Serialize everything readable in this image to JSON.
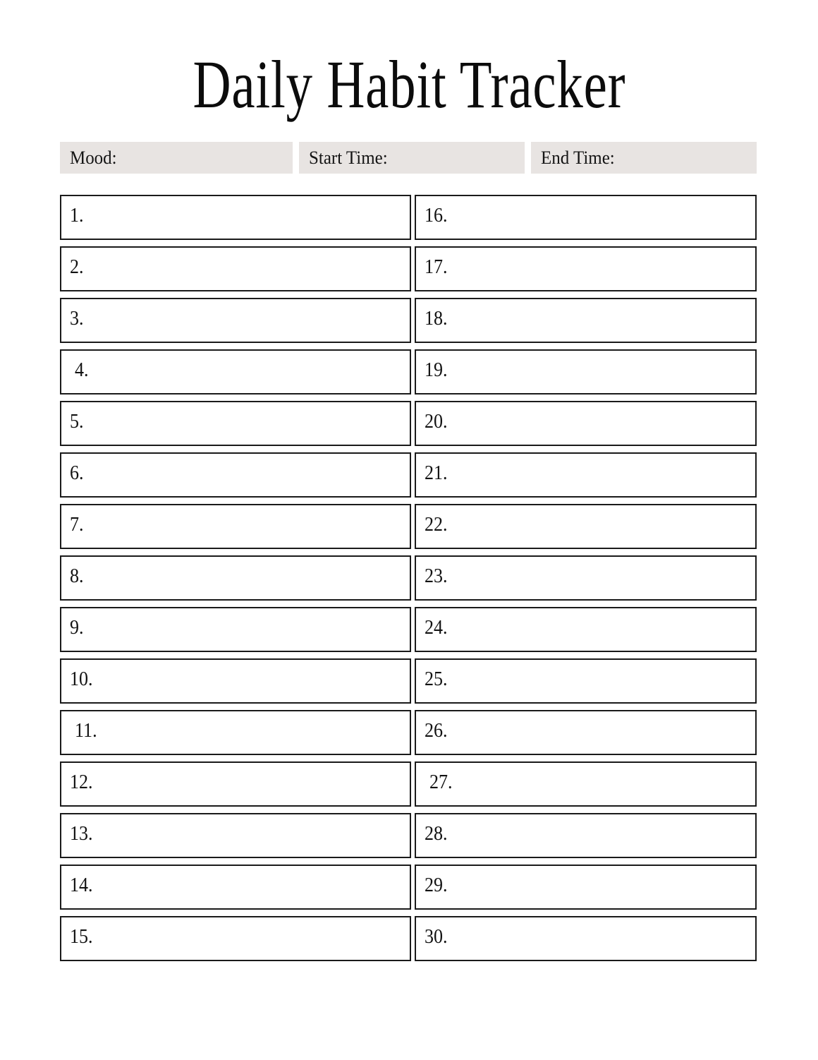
{
  "document": {
    "title": "Daily Habit Tracker",
    "accent_gray": "#E8E4E2",
    "border_color": "#1A1A1A",
    "background": "#FFFFFF"
  },
  "fields": [
    {
      "id": "mood",
      "label": "Mood:",
      "value": ""
    },
    {
      "id": "start_time",
      "label": "Start Time:",
      "value": ""
    },
    {
      "id": "end_time",
      "label": "End Time:",
      "value": ""
    }
  ],
  "checklist": {
    "left_column": [
      {
        "number": "1.",
        "value": "",
        "indent": false
      },
      {
        "number": "2.",
        "value": "",
        "indent": false
      },
      {
        "number": "3.",
        "value": "",
        "indent": false
      },
      {
        "number": "4.",
        "value": "",
        "indent": true
      },
      {
        "number": "5.",
        "value": "",
        "indent": false
      },
      {
        "number": "6.",
        "value": "",
        "indent": false
      },
      {
        "number": "7.",
        "value": "",
        "indent": false
      },
      {
        "number": "8.",
        "value": "",
        "indent": false
      },
      {
        "number": "9.",
        "value": "",
        "indent": false
      },
      {
        "number": "10.",
        "value": "",
        "indent": false
      },
      {
        "number": "11.",
        "value": "",
        "indent": true
      },
      {
        "number": "12.",
        "value": "",
        "indent": false
      },
      {
        "number": "13.",
        "value": "",
        "indent": false
      },
      {
        "number": "14.",
        "value": "",
        "indent": false
      },
      {
        "number": "15.",
        "value": "",
        "indent": false
      }
    ],
    "right_column": [
      {
        "number": "16.",
        "value": "",
        "indent": false
      },
      {
        "number": "17.",
        "value": "",
        "indent": false
      },
      {
        "number": "18.",
        "value": "",
        "indent": false
      },
      {
        "number": "19.",
        "value": "",
        "indent": false
      },
      {
        "number": "20.",
        "value": "",
        "indent": false
      },
      {
        "number": "21.",
        "value": "",
        "indent": false
      },
      {
        "number": "22.",
        "value": "",
        "indent": false
      },
      {
        "number": "23.",
        "value": "",
        "indent": false
      },
      {
        "number": "24.",
        "value": "",
        "indent": false
      },
      {
        "number": "25.",
        "value": "",
        "indent": false
      },
      {
        "number": "26.",
        "value": "",
        "indent": false
      },
      {
        "number": "27.",
        "value": "",
        "indent": true
      },
      {
        "number": "28.",
        "value": "",
        "indent": false
      },
      {
        "number": "29.",
        "value": "",
        "indent": false
      },
      {
        "number": "30.",
        "value": "",
        "indent": false
      }
    ]
  }
}
